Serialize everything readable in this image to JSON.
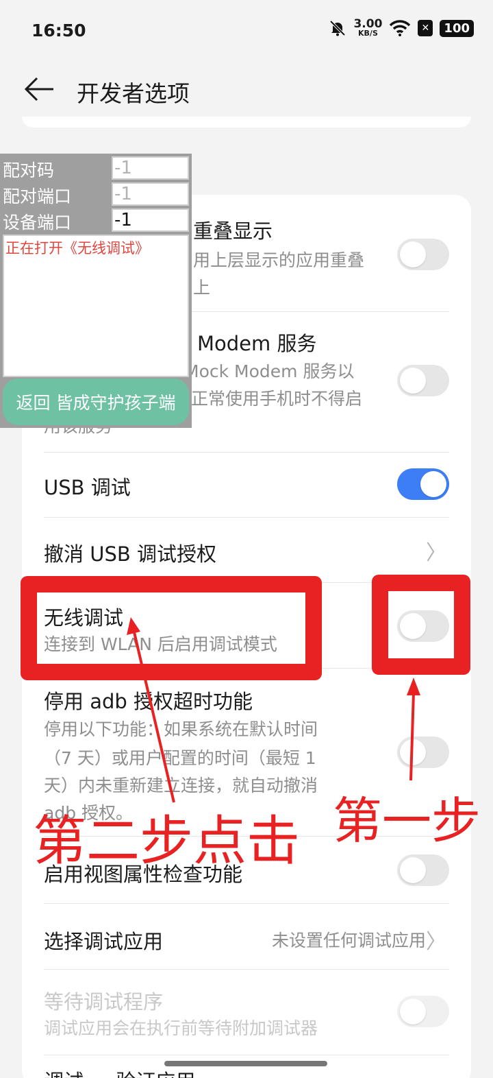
{
  "status_bar": {
    "time": "16:50",
    "net_speed_value": "3.00",
    "net_speed_unit": "KB/S",
    "battery": "100",
    "icons": [
      "bell-muted-icon",
      "wifi-icon",
      "sim-x-icon",
      "battery-icon"
    ]
  },
  "header": {
    "title": "开发者选项",
    "back_icon": "back-arrow-icon"
  },
  "settings": {
    "overlay": {
      "title": "重叠显示",
      "subtitle_1": "用上层显示的应用重叠",
      "subtitle_2": "上",
      "enabled": false
    },
    "modem": {
      "title": "Modem 服务",
      "subtitle_1": "Mock Modem 服务以",
      "subtitle_2": "正常使用手机时不得启",
      "subtitle_3": "用该服务",
      "enabled": false
    },
    "usb_debug": {
      "title": "USB 调试",
      "enabled": true
    },
    "revoke_usb": {
      "title": "撤消 USB 调试授权"
    },
    "wireless_debug": {
      "title": "无线调试",
      "subtitle": "连接到 WLAN 后启用调试模式",
      "enabled": false
    },
    "adb_timeout": {
      "title": "停用 adb 授权超时功能",
      "subtitle_1": "停用以下功能：如果系统在默认时间",
      "subtitle_2": "（7 天）或用户配置的时间（最短 1",
      "subtitle_3": "天）内未重新建立连接，就自动撤消",
      "subtitle_4": "adb 授权。",
      "enabled": false
    },
    "view_attr": {
      "title": "启用视图属性检查功能",
      "enabled": false
    },
    "debug_app": {
      "title": "选择调试应用",
      "value": "未设置任何调试应用"
    },
    "wait_debugger": {
      "title": "等待调试程序",
      "subtitle": "调试应用会在执行前等待附加调试器",
      "enabled": false
    },
    "next_partial": {
      "title": "调试 … 验证应用"
    }
  },
  "overlay_panel": {
    "pair_code_label": "配对码",
    "pair_code_value": "-1",
    "pair_port_label": "配对端口",
    "pair_port_value": "-1",
    "device_port_label": "设备端口",
    "device_port_value": "-1",
    "log": "正在打开《无线调试》",
    "return_button": "返回 皆成守护孩子端"
  },
  "annotations": {
    "step1": "第一步",
    "step2": "第二步点击",
    "color": "#e82222"
  }
}
